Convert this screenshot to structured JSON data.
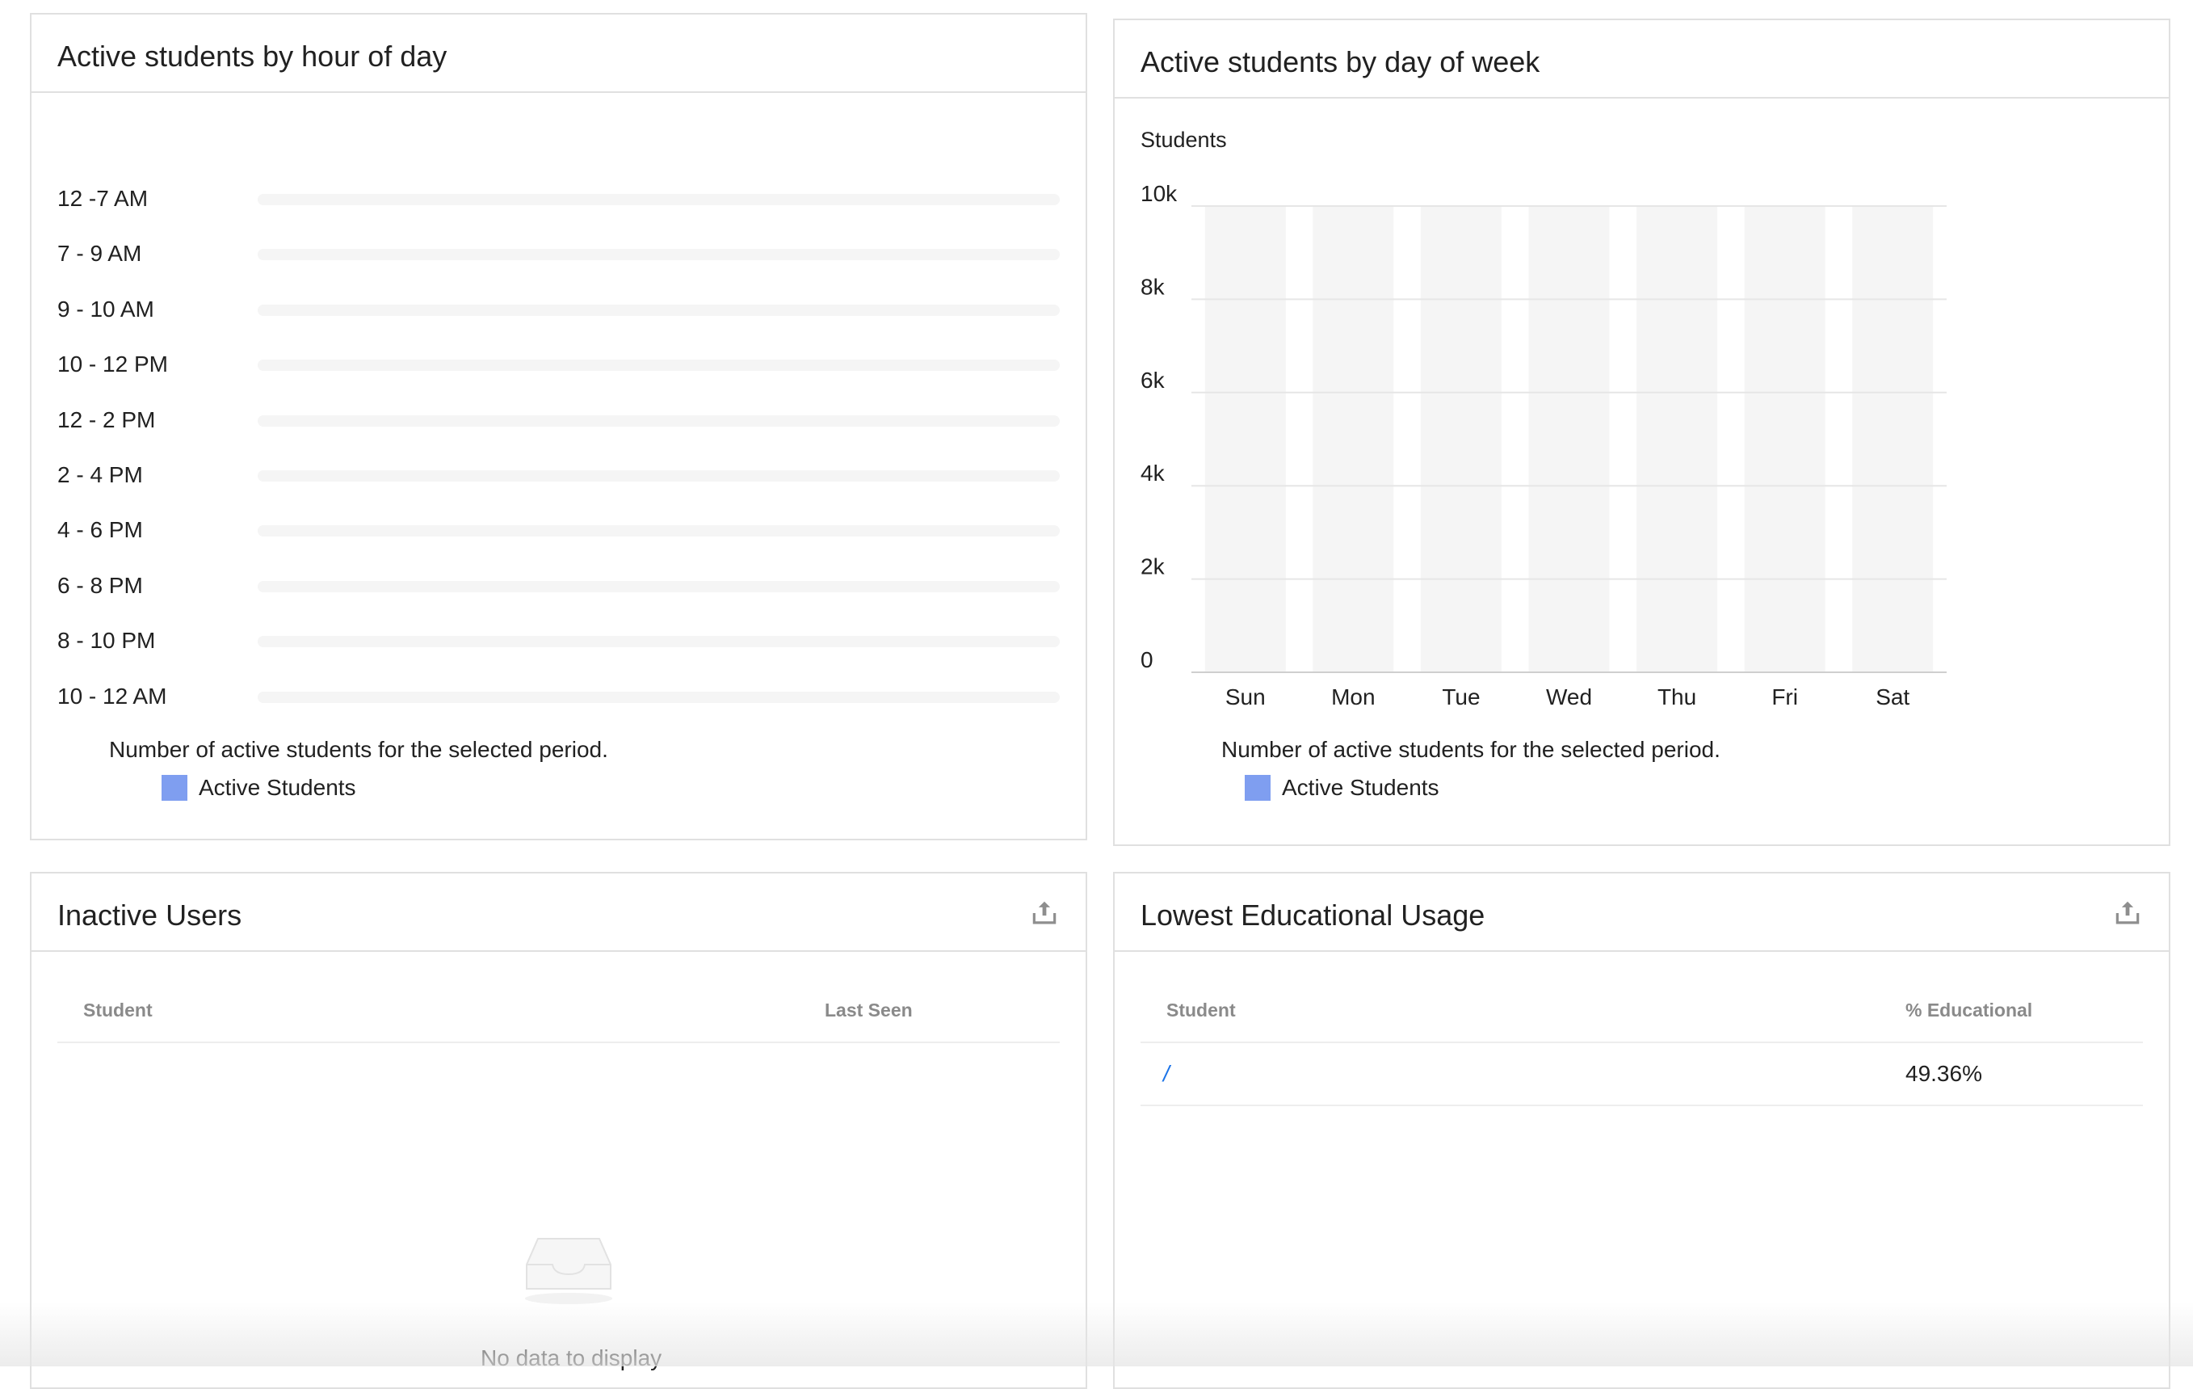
{
  "hour_card": {
    "title": "Active students by hour of day",
    "rows": [
      {
        "label": "12 -7 AM"
      },
      {
        "label": "7 - 9 AM"
      },
      {
        "label": "9 - 10 AM"
      },
      {
        "label": "10 - 12 PM"
      },
      {
        "label": "12 - 2 PM"
      },
      {
        "label": "2 - 4 PM"
      },
      {
        "label": "4 - 6 PM"
      },
      {
        "label": "6 - 8 PM"
      },
      {
        "label": "8 - 10 PM"
      },
      {
        "label": "10 - 12 AM"
      }
    ],
    "note": "Number of active students for the selected period.",
    "legend_label": "Active Students"
  },
  "day_card": {
    "title": "Active students by day of week",
    "note": "Number of active students for the selected period.",
    "legend_label": "Active Students"
  },
  "chart_data": {
    "type": "bar",
    "categories": [
      "Sun",
      "Mon",
      "Tue",
      "Wed",
      "Thu",
      "Fri",
      "Sat"
    ],
    "series": [
      {
        "name": "Active Students",
        "values": [
          0,
          0,
          0,
          0,
          0,
          0,
          0
        ]
      }
    ],
    "title": "Active students by day of week",
    "ylabel": "Students",
    "ylim": [
      0,
      10000
    ],
    "yticks": [
      {
        "v": 0,
        "label": "0"
      },
      {
        "v": 2000,
        "label": "2k"
      },
      {
        "v": 4000,
        "label": "4k"
      },
      {
        "v": 6000,
        "label": "6k"
      },
      {
        "v": 8000,
        "label": "8k"
      },
      {
        "v": 10000,
        "label": "10k"
      }
    ],
    "grid": true
  },
  "inactive_card": {
    "title": "Inactive Users",
    "col_student": "Student",
    "col_last_seen": "Last Seen",
    "empty_text": "No data to display"
  },
  "usage_card": {
    "title": "Lowest Educational Usage",
    "col_student": "Student",
    "col_educational": "% Educational",
    "rows": [
      {
        "student": "/",
        "educational": "49.36%"
      }
    ]
  },
  "colors": {
    "legend_swatch": "#7f9ef0",
    "bar_background": "#f5f5f5",
    "grid_line": "#e6e6e6",
    "icon_gray": "#8e8e8e",
    "link_blue": "#1a73e8"
  },
  "icons": {
    "export": "export-icon",
    "empty": "empty-inbox-icon"
  }
}
